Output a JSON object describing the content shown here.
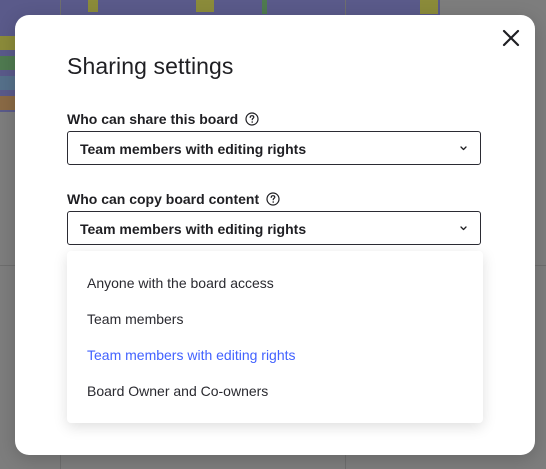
{
  "dialog": {
    "title": "Sharing settings",
    "share_label": "Who can share this board",
    "share_value": "Team members with editing rights",
    "copy_label": "Who can copy board content",
    "copy_value": "Team members with editing rights",
    "copy_options": [
      "Anyone with the board access",
      "Team members",
      "Team members with editing rights",
      "Board Owner and Co-owners"
    ],
    "selected_option": "Team members with editing rights"
  },
  "colors": {
    "accent": "#4262ff",
    "text": "#1f1f23"
  }
}
